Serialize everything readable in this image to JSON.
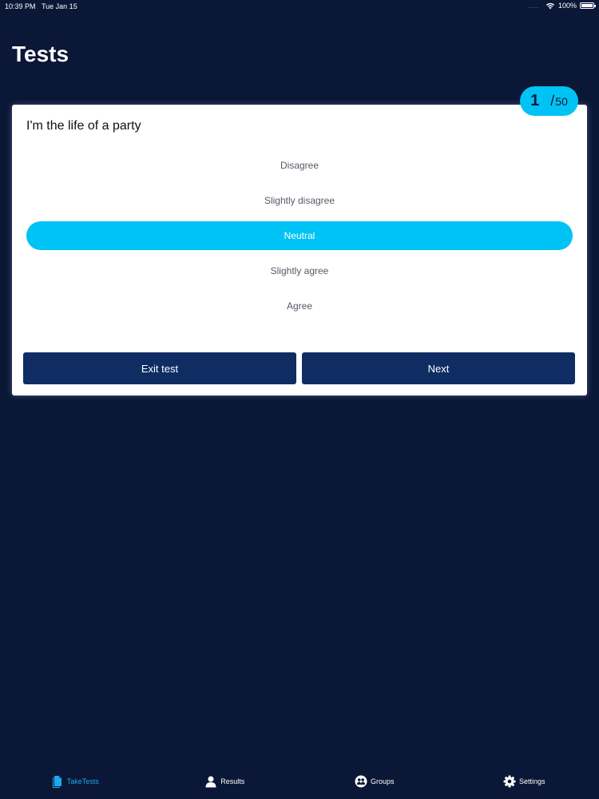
{
  "status_bar": {
    "time": "10:39 PM",
    "date": "Tue Jan 15",
    "dots": "....",
    "battery": "100%"
  },
  "page": {
    "title": "Tests"
  },
  "progress": {
    "current": "1",
    "slash": "/",
    "total": "50"
  },
  "question": {
    "text": "I'm the life of a party",
    "options": [
      {
        "label": "Disagree",
        "selected": false
      },
      {
        "label": "Slightly disagree",
        "selected": false
      },
      {
        "label": "Neutral",
        "selected": true
      },
      {
        "label": "Slightly agree",
        "selected": false
      },
      {
        "label": "Agree",
        "selected": false
      }
    ]
  },
  "actions": {
    "exit_label": "Exit test",
    "next_label": "Next"
  },
  "tabs": [
    {
      "label": "TakeTests",
      "icon": "document-icon",
      "active": true
    },
    {
      "label": "Results",
      "icon": "person-icon",
      "active": false
    },
    {
      "label": "Groups",
      "icon": "group-icon",
      "active": false
    },
    {
      "label": "Settings",
      "icon": "gear-icon",
      "active": false
    }
  ],
  "colors": {
    "background": "#0b1736",
    "accent": "#00c3f5",
    "button": "#0f2d63",
    "active_tab": "#1ea8ec"
  }
}
